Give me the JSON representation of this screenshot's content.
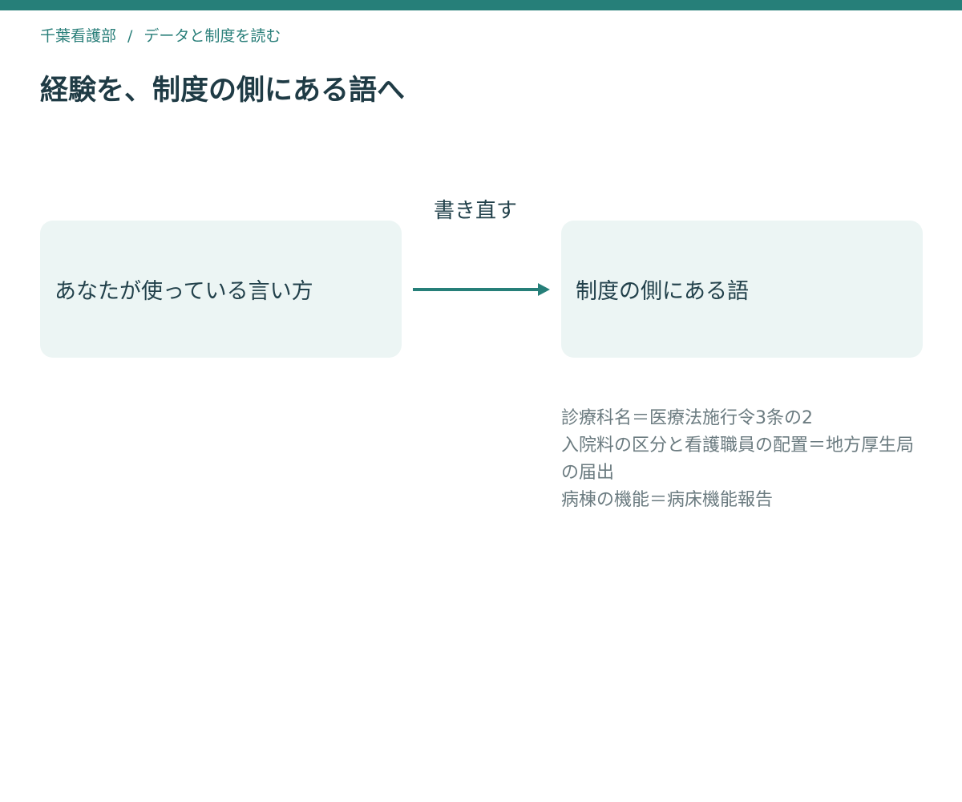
{
  "breadcrumb": {
    "items": [
      "千葉看護部",
      "データと制度を読む"
    ],
    "separator": "/"
  },
  "page": {
    "title": "経験を、制度の側にある語へ"
  },
  "diagram": {
    "source_label": "あなたが使っている言い方",
    "arrow_label": "書き直す",
    "target_label": "制度の側にある語",
    "examples": [
      "診療科名＝医療法施行令3条の2",
      "入院料の区分と看護職員の配置＝地方厚生局の届出",
      "病棟の機能＝病床機能報告"
    ]
  },
  "colors": {
    "accent": "#267f79",
    "box_fill": "#ecf5f4",
    "title_text": "#1f3b45",
    "note_text": "#6b7b80"
  }
}
